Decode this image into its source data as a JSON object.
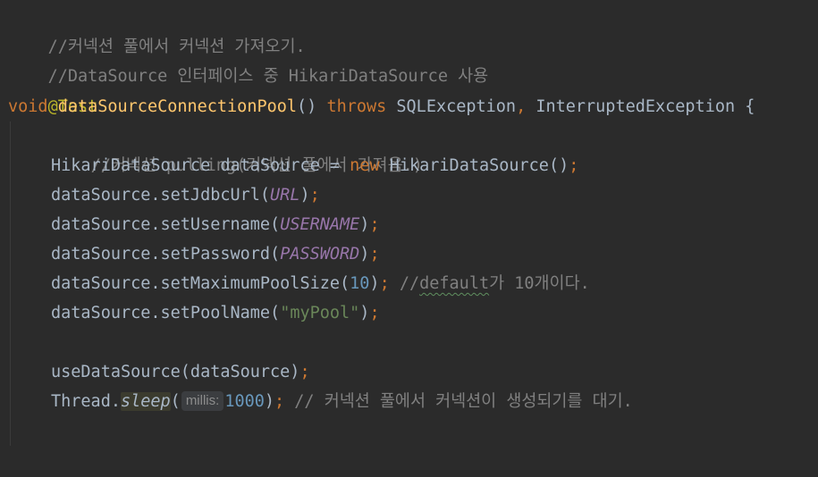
{
  "lines": {
    "l1": {
      "comment": "//커넥션 풀에서 커넥션 가져오기."
    },
    "l2": {
      "comment": "//DataSource 인터페이스 중 HikariDataSource 사용"
    },
    "l3": {
      "annotation": "@Test"
    },
    "l4": {
      "kw_void": "void",
      "method": "dataSourceConnectionPool",
      "parens": "()",
      "kw_throws": "throws",
      "ex1": "SQLException",
      "comma": ",",
      "ex2": "InterruptedException",
      "brace": "{"
    },
    "l5": {
      "comment": "//커넥션 pulling(커넥션 풀에서 가져옴.)"
    },
    "l6": {
      "type": "HikariDataSource",
      "var": "dataSource",
      "eq": "=",
      "kw_new": "new",
      "ctor": "HikariDataSource",
      "parens": "()",
      "semi": ";"
    },
    "l7": {
      "call": "dataSource.setJdbcUrl(",
      "arg": "URL",
      "close": ")",
      "semi": ";"
    },
    "l8": {
      "call": "dataSource.setUsername(",
      "arg": "USERNAME",
      "close": ")",
      "semi": ";"
    },
    "l9": {
      "call": "dataSource.setPassword(",
      "arg": "PASSWORD",
      "close": ")",
      "semi": ";"
    },
    "l10": {
      "call": "dataSource.setMaximumPoolSize(",
      "arg": "10",
      "close": ")",
      "semi": ";",
      "comment_prefix": "//",
      "comment_word": "default",
      "comment_rest": "가 10개이다."
    },
    "l11": {
      "call": "dataSource.setPoolName(",
      "arg": "\"myPool\"",
      "close": ")",
      "semi": ";"
    },
    "l13": {
      "call": "useDataSource(dataSource)",
      "semi": ";"
    },
    "l14": {
      "cls": "Thread.",
      "method": "sleep",
      "open": "(",
      "hint": "millis:",
      "arg": "1000",
      "close": ")",
      "semi": ";",
      "comment": "// 커넥션 풀에서 커넥션이 생성되기를 대기."
    },
    "l16": {
      "brace": "}"
    }
  },
  "colors": {
    "background": "#2b2b2b",
    "default_text": "#a9b7c6",
    "comment": "#808080",
    "keyword": "#cc7832",
    "method_decl": "#ffc66d",
    "annotation": "#bbb529",
    "constant": "#9876aa",
    "number": "#6897bb",
    "string": "#6a8759"
  }
}
